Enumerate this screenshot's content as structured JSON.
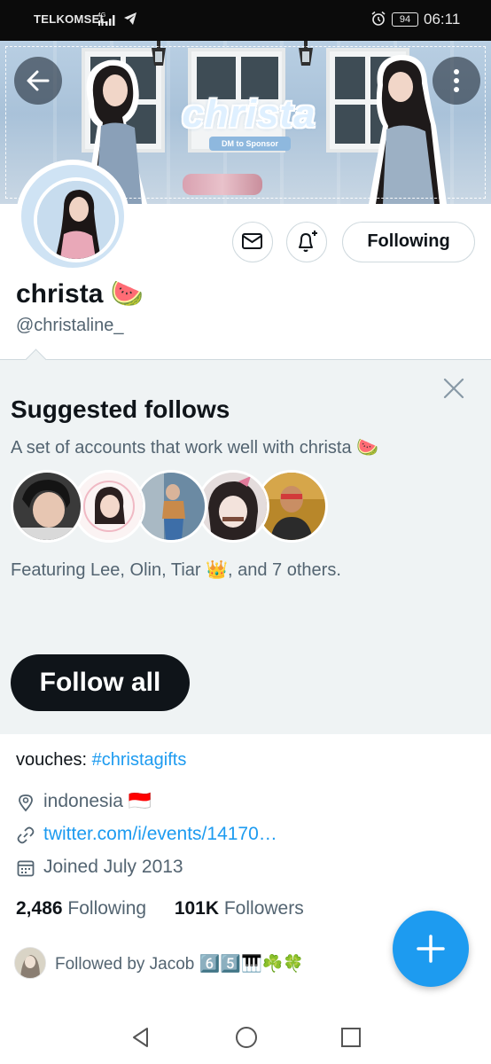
{
  "status_bar": {
    "carrier": "TELKOMSEL",
    "network": "4G",
    "battery": "94",
    "time": "06:11"
  },
  "banner": {
    "title": "christa",
    "subtitle": "DM to Sponsor"
  },
  "profile": {
    "display_name": "christa 🍉",
    "handle": "@christaline_",
    "following_button": "Following"
  },
  "suggested": {
    "title": "Suggested follows",
    "description": "A set of accounts that work well with christa 🍉",
    "featuring": "Featuring Lee, Olin, Tiar 👑, and 7 others.",
    "follow_all": "Follow all"
  },
  "bio": {
    "prefix": "vouches: ",
    "hashtag": "#christagifts"
  },
  "meta": {
    "location": "indonesia 🇮🇩",
    "link": "twitter.com/i/events/14170…",
    "joined": "Joined July 2013"
  },
  "stats": {
    "following_count": "2,486",
    "following_label": "Following",
    "followers_count": "101K",
    "followers_label": "Followers"
  },
  "followed_by": {
    "text": "Followed by Jacob 6️⃣5️⃣🎹☘️🍀"
  },
  "colors": {
    "accent": "#1d9bf0",
    "text_primary": "#0f1419",
    "text_secondary": "#536471",
    "panel_bg": "#eff3f4"
  }
}
